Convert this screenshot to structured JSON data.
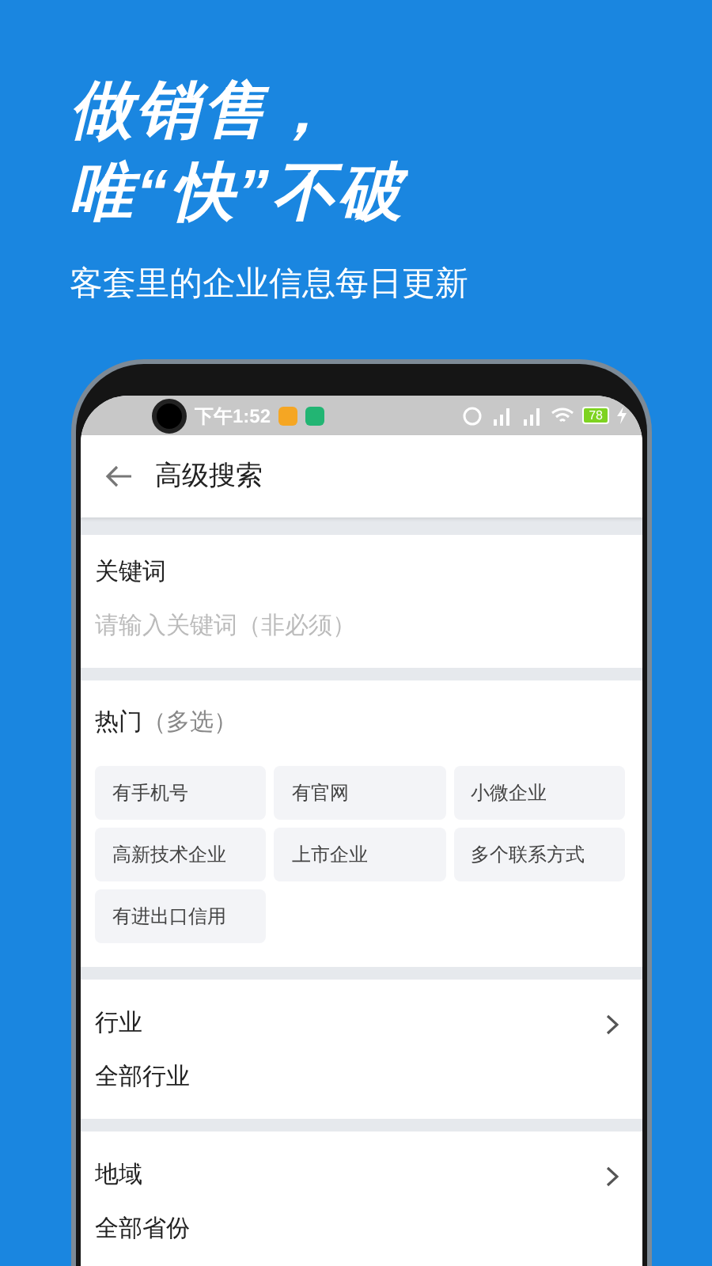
{
  "headline": [
    "做销售，",
    "唯“快”不破"
  ],
  "subtitle": "客套里的企业信息每日更新",
  "status_bar": {
    "time": "下午1:52",
    "battery": "78"
  },
  "header": {
    "title": "高级搜索"
  },
  "keyword": {
    "label": "关键词",
    "placeholder": "请输入关键词（非必须）"
  },
  "hot": {
    "title": "热门",
    "note": "（多选）",
    "options": [
      {
        "label": "有手机号",
        "selected": false
      },
      {
        "label": "有官网",
        "selected": false
      },
      {
        "label": "小微企业",
        "selected": false
      },
      {
        "label": "高新技术企业",
        "selected": false
      },
      {
        "label": "上市企业",
        "selected": false
      },
      {
        "label": "多个联系方式",
        "selected": false
      },
      {
        "label": "有进出口信用",
        "selected": false
      }
    ]
  },
  "filters": [
    {
      "label": "行业",
      "value": "全部行业"
    },
    {
      "label": "地域",
      "value": "全部省份"
    }
  ]
}
